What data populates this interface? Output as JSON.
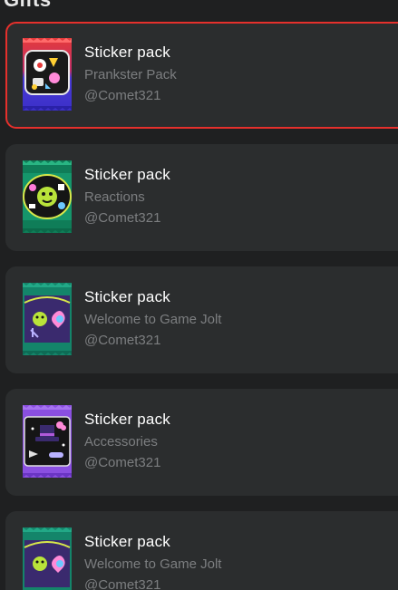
{
  "header": {
    "title": "Gifts"
  },
  "items": [
    {
      "type_label": "Sticker pack",
      "pack_name": "Prankster Pack",
      "author": "@Comet321",
      "selected": true,
      "theme": "prankster"
    },
    {
      "type_label": "Sticker pack",
      "pack_name": "Reactions",
      "author": "@Comet321",
      "selected": false,
      "theme": "reactions"
    },
    {
      "type_label": "Sticker pack",
      "pack_name": "Welcome to Game Jolt",
      "author": "@Comet321",
      "selected": false,
      "theme": "welcome"
    },
    {
      "type_label": "Sticker pack",
      "pack_name": "Accessories",
      "author": "@Comet321",
      "selected": false,
      "theme": "accessories"
    },
    {
      "type_label": "Sticker pack",
      "pack_name": "Welcome to Game Jolt",
      "author": "@Comet321",
      "selected": false,
      "theme": "welcome"
    }
  ],
  "colors": {
    "page_bg": "#1f2021",
    "card_bg": "#2b2d2e",
    "selected_border": "#e5302c",
    "title_text": "#ffffff",
    "secondary_text": "#7c7e80"
  }
}
